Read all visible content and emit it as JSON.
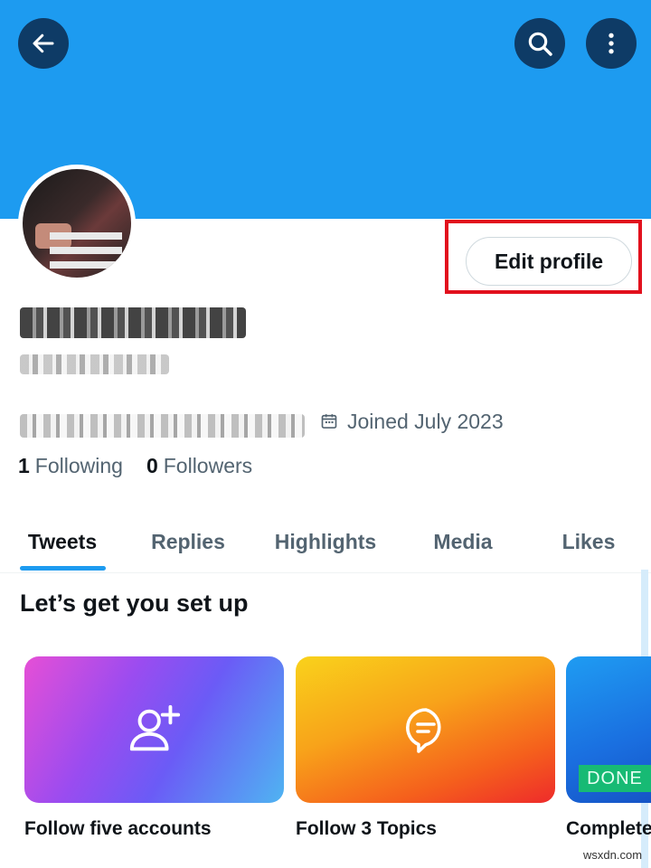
{
  "theme": {
    "banner_color": "#1d9bf0",
    "accent": "#1d9bf0",
    "highlight_border": "#e2101d",
    "done_color": "#17ba74"
  },
  "header": {
    "back_icon": "arrow-left-icon",
    "search_icon": "search-icon",
    "more_icon": "more-vertical-icon"
  },
  "profile": {
    "edit_button_label": "Edit profile",
    "joined_text": "Joined July 2023",
    "joined_icon": "calendar-icon",
    "following_count": "1",
    "following_label": "Following",
    "followers_count": "0",
    "followers_label": "Followers"
  },
  "tabs": [
    {
      "label": "Tweets",
      "active": true
    },
    {
      "label": "Replies",
      "active": false
    },
    {
      "label": "Highlights",
      "active": false
    },
    {
      "label": "Media",
      "active": false
    },
    {
      "label": "Likes",
      "active": false
    }
  ],
  "setup": {
    "title": "Let’s get you set up",
    "cards": [
      {
        "label": "Follow five accounts",
        "icon": "person-add-icon"
      },
      {
        "label": "Follow 3 Topics",
        "icon": "topic-bubble-icon"
      },
      {
        "label": "Complete",
        "badge": "DONE"
      }
    ]
  },
  "watermark": "wsxdn.com"
}
